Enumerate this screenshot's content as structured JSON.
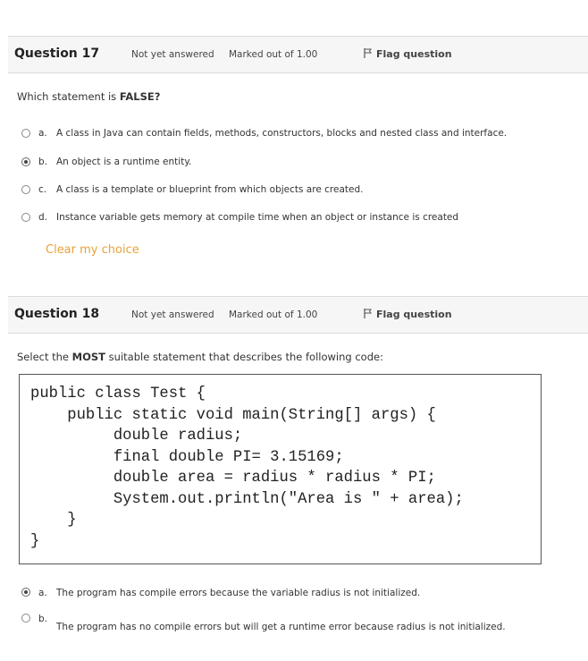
{
  "q17": {
    "title": "Question 17",
    "state": "Not yet answered",
    "grade": "Marked out of 1.00",
    "flag_label": "Flag question",
    "text_prefix": "Which statement is ",
    "text_bold": "FALSE?",
    "options": [
      {
        "letter": "a.",
        "text": "A class in Java can contain fields, methods, constructors, blocks and nested class and interface.",
        "selected": false
      },
      {
        "letter": "b.",
        "text": "An object is a runtime entity.",
        "selected": true
      },
      {
        "letter": "c.",
        "text": "A class is a template or blueprint from which objects are created.",
        "selected": false
      },
      {
        "letter": "d.",
        "text": "Instance variable gets memory at compile time when an object or instance is created",
        "selected": false
      }
    ],
    "clear_label": "Clear my choice"
  },
  "q18": {
    "title": "Question 18",
    "state": "Not yet answered",
    "grade": "Marked out of 1.00",
    "flag_label": "Flag question",
    "text_prefix": "Select the ",
    "text_bold": "MOST",
    "text_suffix": " suitable statement that describes the following code:",
    "code": "public class Test {\n    public static void main(String[] args) {\n         double radius;\n         final double PI= 3.15169;\n         double area = radius * radius * PI;\n         System.out.println(\"Area is \" + area);\n    }\n}",
    "options": [
      {
        "letter": "a.",
        "text": "The program has compile errors because the variable radius is not initialized.",
        "selected": true
      },
      {
        "letter": "b.",
        "text": "The program has no compile errors but will get a runtime error because radius is not initialized.",
        "selected": false
      }
    ]
  },
  "colors": {
    "clear_link": "#e7a23a",
    "header_bg": "#f6f6f6"
  },
  "icons": {
    "flag": "flag-icon"
  }
}
